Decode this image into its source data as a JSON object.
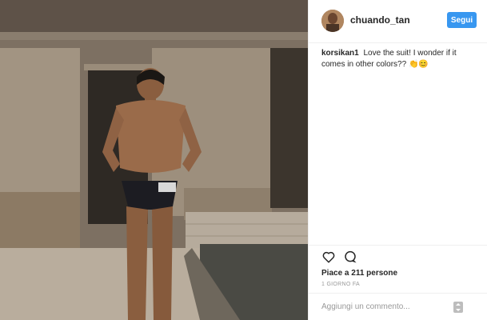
{
  "post": {
    "username": "chuando_tan",
    "follow_label": "Segui",
    "comment": {
      "user": "korsikan1",
      "text": "Love the suit! I wonder if it comes in other colors?? 👏😊"
    },
    "likes_text": "Piace a 211 persone",
    "timestamp": "1 GIORNO FA",
    "comment_placeholder": "Aggiungi un commento..."
  },
  "icons": {
    "like": "heart-outline-icon",
    "comment": "speech-bubble-icon",
    "more": "more-options-icon"
  },
  "colors": {
    "accent": "#3897f0",
    "text": "#262626",
    "muted": "#999999",
    "border": "#efefef"
  }
}
